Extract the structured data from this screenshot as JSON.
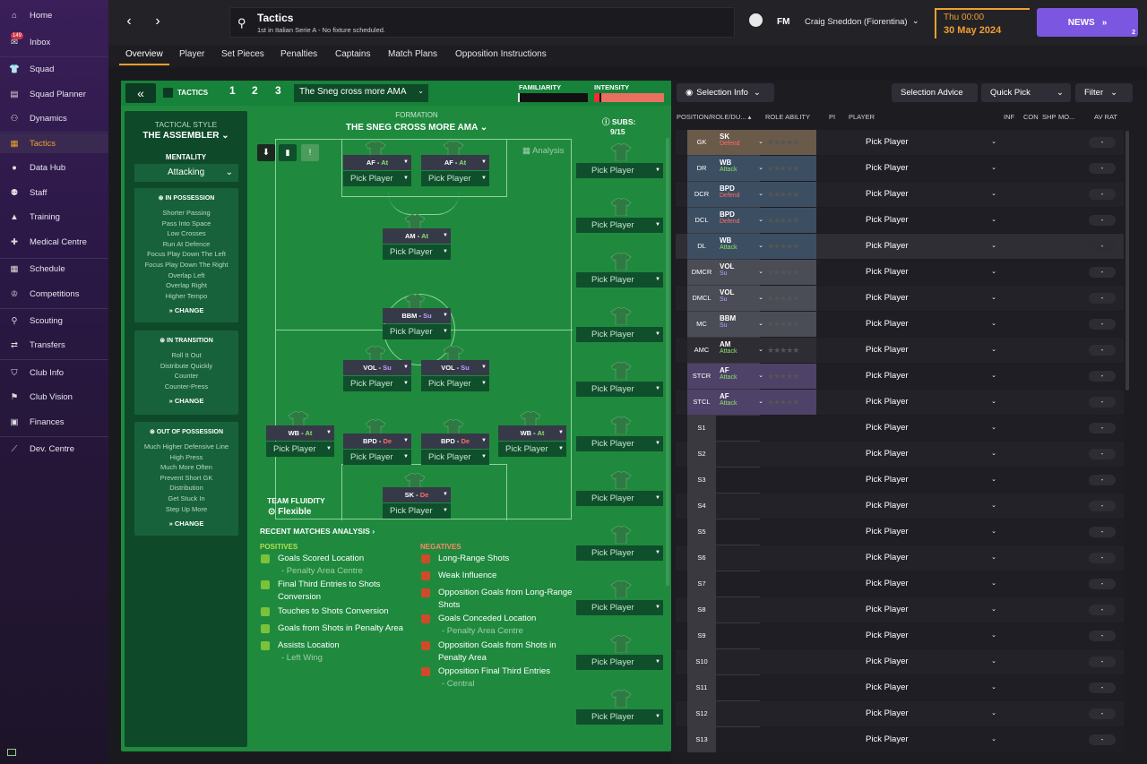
{
  "sidebar": {
    "items": [
      {
        "label": "Home",
        "icon": "home-icon"
      },
      {
        "label": "Inbox",
        "icon": "inbox-icon",
        "badge": "149"
      },
      {
        "label": "Squad",
        "icon": "squad-icon"
      },
      {
        "label": "Squad Planner",
        "icon": "squad-planner-icon"
      },
      {
        "label": "Dynamics",
        "icon": "dynamics-icon"
      },
      {
        "label": "Tactics",
        "icon": "tactics-icon",
        "active": true
      },
      {
        "label": "Data Hub",
        "icon": "data-hub-icon"
      },
      {
        "label": "Staff",
        "icon": "staff-icon"
      },
      {
        "label": "Training",
        "icon": "training-icon"
      },
      {
        "label": "Medical Centre",
        "icon": "medical-icon"
      },
      {
        "label": "Schedule",
        "icon": "schedule-icon"
      },
      {
        "label": "Competitions",
        "icon": "trophy-icon"
      },
      {
        "label": "Scouting",
        "icon": "scouting-icon"
      },
      {
        "label": "Transfers",
        "icon": "transfers-icon"
      },
      {
        "label": "Club Info",
        "icon": "club-info-icon"
      },
      {
        "label": "Club Vision",
        "icon": "club-vision-icon"
      },
      {
        "label": "Finances",
        "icon": "finances-icon"
      },
      {
        "label": "Dev. Centre",
        "icon": "dev-centre-icon"
      }
    ]
  },
  "header": {
    "title": "Tactics",
    "subtitle": "1st in Italian Serie A - No fixture scheduled.",
    "fm_logo": "FM",
    "manager": "Craig Sneddon (Fiorentina)",
    "time": "Thu 00:00",
    "date": "30 May 2024",
    "news": "NEWS",
    "news_count": "2"
  },
  "tabs": [
    "Overview",
    "Player",
    "Set Pieces",
    "Penalties",
    "Captains",
    "Match Plans",
    "Opposition Instructions"
  ],
  "tactic": {
    "section": "TACTICS",
    "slots": [
      "1",
      "2",
      "3"
    ],
    "name": "The Sneg cross more AMA",
    "familiarity_label": "FAMILIARITY",
    "intensity_label": "INTENSITY",
    "familiarity": 0.03,
    "intensity": 0.08,
    "style_label": "TACTICAL STYLE",
    "style": "THE ASSEMBLER",
    "mentality_label": "MENTALITY",
    "mentality": "Attacking",
    "in_possession": {
      "title": "IN POSSESSION",
      "items": [
        "Shorter Passing",
        "Pass Into Space",
        "Low Crosses",
        "Run At Defence",
        "Focus Play Down The Left",
        "Focus Play Down The Right",
        "Overlap Left",
        "Overlap Right",
        "Higher Tempo"
      ]
    },
    "in_transition": {
      "title": "IN TRANSITION",
      "items": [
        "Roll It Out",
        "Distribute Quickly",
        "Counter",
        "Counter-Press"
      ]
    },
    "out_possession": {
      "title": "OUT OF POSSESSION",
      "items": [
        "Much Higher Defensive Line",
        "High Press",
        "Much More Often",
        "Prevent Short GK",
        "Distribution",
        "Get Stuck In",
        "Step Up More"
      ]
    },
    "change": "CHANGE",
    "formation_label": "FORMATION",
    "formation": "THE SNEG CROSS MORE AMA",
    "subs_label": "SUBS:",
    "subs_count": "9/15",
    "analysis_btn": "Analysis",
    "fluidity_label": "TEAM FLUIDITY",
    "fluidity": "Flexible",
    "pick": "Pick Player"
  },
  "pitch_slots": [
    {
      "role": "AF",
      "duty": "At",
      "cls": "ra"
    },
    {
      "role": "AF",
      "duty": "At",
      "cls": "ra"
    },
    {
      "role": "AM",
      "duty": "At",
      "cls": "ra"
    },
    {
      "role": "BBM",
      "duty": "Su",
      "cls": "rk"
    },
    {
      "role": "VOL",
      "duty": "Su",
      "cls": "rk"
    },
    {
      "role": "VOL",
      "duty": "Su",
      "cls": "rk"
    },
    {
      "role": "WB",
      "duty": "At",
      "cls": "ra"
    },
    {
      "role": "BPD",
      "duty": "De",
      "cls": "rd"
    },
    {
      "role": "BPD",
      "duty": "De",
      "cls": "rd"
    },
    {
      "role": "WB",
      "duty": "At",
      "cls": "ra"
    },
    {
      "role": "SK",
      "duty": "De",
      "cls": "rd"
    }
  ],
  "analysis": {
    "title": "RECENT MATCHES ANALYSIS",
    "positives_label": "POSITIVES",
    "negatives_label": "NEGATIVES",
    "positives": [
      {
        "text": "Goals Scored Location",
        "sub": "- Penalty Area Centre"
      },
      {
        "text": "Final Third Entries to Shots Conversion",
        "sub": ""
      },
      {
        "text": "Touches to Shots Conversion",
        "sub": ""
      },
      {
        "text": "Goals from Shots in Penalty Area",
        "sub": ""
      },
      {
        "text": "Assists Location",
        "sub": "- Left Wing"
      }
    ],
    "negatives": [
      {
        "text": "Long-Range Shots",
        "sub": ""
      },
      {
        "text": "Weak Influence",
        "sub": ""
      },
      {
        "text": "Opposition Goals from Long-Range Shots",
        "sub": ""
      },
      {
        "text": "Goals Conceded Location",
        "sub": "- Penalty Area Centre"
      },
      {
        "text": "Opposition Goals from Shots in Penalty Area",
        "sub": ""
      },
      {
        "text": "Opposition Final Third Entries",
        "sub": "- Central"
      }
    ]
  },
  "right": {
    "selection_info": "Selection Info",
    "selection_advice": "Selection Advice",
    "quick_pick": "Quick Pick",
    "filter": "Filter",
    "cols": {
      "pos": "POSITION/ROLE/DU...",
      "ability": "ROLE ABILITY",
      "pi": "PI",
      "player": "PLAYER",
      "inf": "INF",
      "con": "CON",
      "shp": "SHP",
      "mo": "MO...",
      "avrat": "AV RAT"
    },
    "rows": [
      {
        "pos": "GK",
        "role": "SK",
        "duty": "Defend",
        "dcls": "dfd",
        "bg": "#6a5a4a"
      },
      {
        "pos": "DR",
        "role": "WB",
        "duty": "Attack",
        "dcls": "att",
        "bg": "#3c4e62"
      },
      {
        "pos": "DCR",
        "role": "BPD",
        "duty": "Defend",
        "dcls": "dfd",
        "bg": "#3c4e62"
      },
      {
        "pos": "DCL",
        "role": "BPD",
        "duty": "Defend",
        "dcls": "dfd",
        "bg": "#3c4e62"
      },
      {
        "pos": "DL",
        "role": "WB",
        "duty": "Attack",
        "dcls": "att",
        "bg": "#3c4e62"
      },
      {
        "pos": "DMCR",
        "role": "VOL",
        "duty": "Su",
        "dcls": "sup",
        "bg": "#4a4c56"
      },
      {
        "pos": "DMCL",
        "role": "VOL",
        "duty": "Su",
        "dcls": "sup",
        "bg": "#4a4c56"
      },
      {
        "pos": "MC",
        "role": "BBM",
        "duty": "Su",
        "dcls": "sup",
        "bg": "#4a4c56"
      },
      {
        "pos": "AMC",
        "role": "AM",
        "duty": "Attack",
        "dcls": "att",
        "bg": "#2e2d34"
      },
      {
        "pos": "STCR",
        "role": "AF",
        "duty": "Attack",
        "dcls": "att",
        "bg": "#4e4268"
      },
      {
        "pos": "STCL",
        "role": "AF",
        "duty": "Attack",
        "dcls": "att",
        "bg": "#4e4268"
      },
      {
        "pos": "S1"
      },
      {
        "pos": "S2"
      },
      {
        "pos": "S3"
      },
      {
        "pos": "S4"
      },
      {
        "pos": "S5"
      },
      {
        "pos": "S6"
      },
      {
        "pos": "S7"
      },
      {
        "pos": "S8"
      },
      {
        "pos": "S9"
      },
      {
        "pos": "S10"
      },
      {
        "pos": "S11"
      },
      {
        "pos": "S12"
      },
      {
        "pos": "S13"
      }
    ],
    "av": "-"
  },
  "colors": {
    "accent": "#f0a030",
    "news": "#7b56e0",
    "pitch": "#1f8a3e",
    "attack": "#8ee06a",
    "defend": "#ff6a6a",
    "support": "#b9a0ff"
  }
}
